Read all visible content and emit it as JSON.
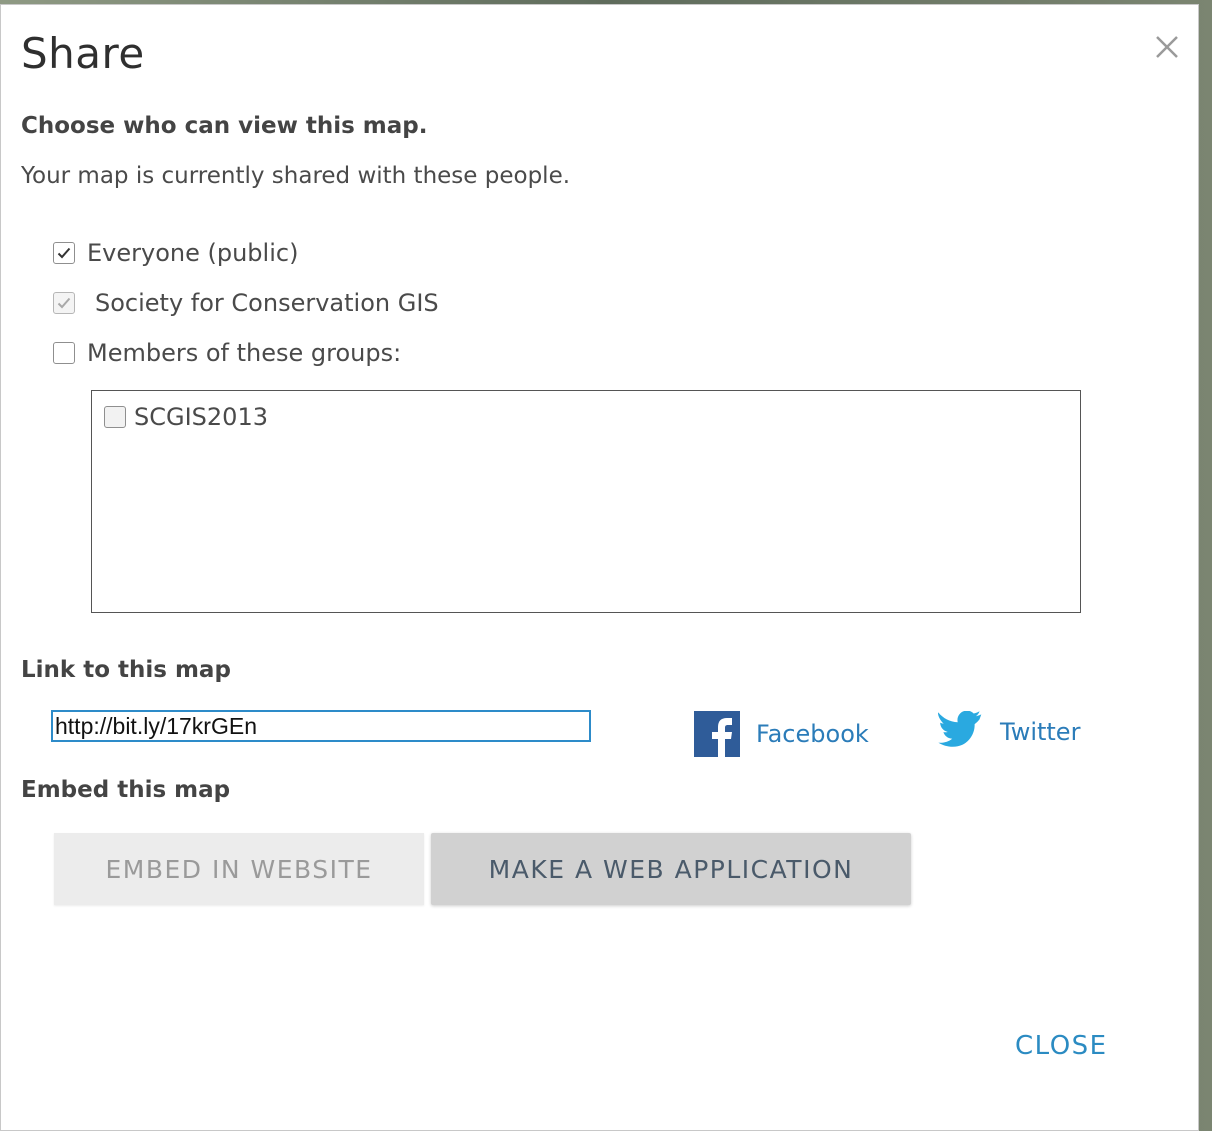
{
  "dialog": {
    "title": "Share",
    "close_icon": "close-icon"
  },
  "visibility": {
    "heading": "Choose who can view this map.",
    "description": "Your map is currently shared with these people.",
    "options": [
      {
        "label": "Everyone (public)",
        "checked": true,
        "disabled": false
      },
      {
        "label": "Society for Conservation GIS",
        "checked": true,
        "disabled": true
      },
      {
        "label": "Members of these groups:",
        "checked": false,
        "disabled": false
      }
    ],
    "groups": [
      {
        "label": "SCGIS2013",
        "checked": false
      }
    ]
  },
  "link": {
    "heading": "Link to this map",
    "url": "http://bit.ly/17krGEn",
    "facebook_label": "Facebook",
    "facebook_icon": "facebook-icon",
    "twitter_label": "Twitter",
    "twitter_icon": "twitter-icon"
  },
  "embed": {
    "heading": "Embed this map",
    "embed_button": "EMBED IN WEBSITE",
    "webapp_button": "MAKE A WEB APPLICATION"
  },
  "footer": {
    "close_label": "CLOSE"
  },
  "colors": {
    "accent": "#2b8bc2",
    "facebook": "#2f5c99",
    "twitter": "#2aa9e0"
  }
}
